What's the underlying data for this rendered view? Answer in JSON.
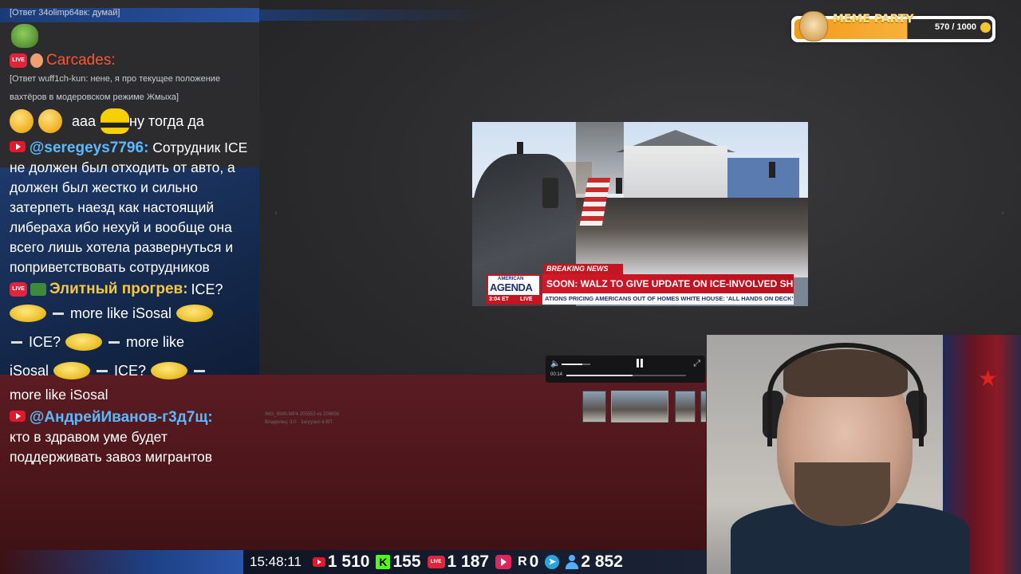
{
  "chat": {
    "reply_top": "[Ответ 34olimp64вк: думай]",
    "messages": [
      {
        "user": "Carcades:",
        "reply": "[Ответ wuff1ch-kun: нене, я про текущее положение вахтёров в модеровском режиме Жмыха]",
        "text": "ааа",
        "text2": "ну тогда да"
      },
      {
        "user": "@seregeys7796:",
        "text": "Сотрудник ICE не должен был отходить от авто, а должен был жестко и сильно затерпеть наезд как настоящий либераха ибо нехуй и вообще она всего лишь хотела развернуться и поприветствовать сотрудников"
      },
      {
        "user": "Элитный прогрев:",
        "parts": [
          "ICE?",
          "more like iSosal",
          "ICE?",
          "more like",
          "iSosal",
          "ICE?",
          "more like iSosal"
        ]
      },
      {
        "user": "@АндрейИванов-г3д7щ:",
        "text": "кто в здравом уме будет поддерживать завоз мигрантов"
      }
    ]
  },
  "meme_party": {
    "title": "MEME PARTY",
    "progress": "570 / 1000",
    "progress_value": 0.57
  },
  "video": {
    "breaking": "BREAKING NEWS",
    "logo_small": "AMERICAN",
    "logo_big": "AGENDA",
    "clock": "3:04 ET",
    "live": "LIVE",
    "headline": "SOON: WALZ TO GIVE UPDATE ON ICE-INVOLVED SHOOTING",
    "ticker": "ATIONS PRICING AMERICANS OUT OF HOMES     WHITE HOUSE: 'ALL HANDS ON DECK' IN FR"
  },
  "player": {
    "current_time": "00:14",
    "progress": 0.55,
    "volume": 0.7
  },
  "file_info": {
    "line1": "IMG_8990.MP4 205553 из 209856",
    "line2": "Владелец: 3.0 · Загрузил в ВП"
  },
  "statbar": {
    "clock": "15:48:11",
    "youtube": "1 510",
    "kick": "155",
    "live": "1 187",
    "rutube": "0",
    "viewers": "2 852"
  },
  "icons": {
    "kick_letter": "K",
    "r_letter": "R",
    "tg_glyph": "➤",
    "live_badge": "LIVE"
  }
}
